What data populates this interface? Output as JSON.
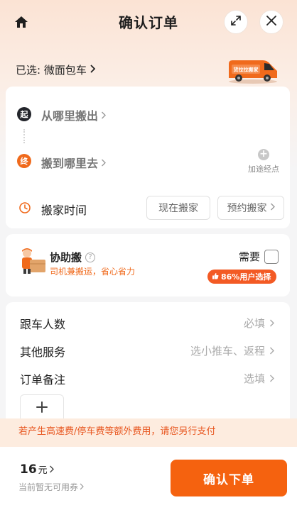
{
  "header": {
    "title": "确认订单",
    "home_icon": "home-icon",
    "expand_icon": "expand-icon",
    "close_icon": "close-icon"
  },
  "vehicle": {
    "selected_label": "已选: 微面包车",
    "van_text": "货拉拉搬家"
  },
  "route": {
    "start_badge": "起",
    "end_badge": "终",
    "from_placeholder": "从哪里搬出",
    "to_placeholder": "搬到哪里去",
    "add_stop_icon": "+",
    "add_stop_label": "加途经点",
    "time_label": "搬家时间",
    "time_now": "现在搬家",
    "time_schedule": "预约搬家"
  },
  "helper": {
    "title": "协助搬",
    "help_icon": "?",
    "subtitle": "司机兼搬运，省心省力",
    "need_label": "需要",
    "badge": "86%用户选择",
    "need_checked": false
  },
  "details": {
    "rows": [
      {
        "label": "跟车人数",
        "value": "必填"
      },
      {
        "label": "其他服务",
        "value": "选小推车、返程"
      },
      {
        "label": "订单备注",
        "value": "选填"
      }
    ],
    "add_photo_icon": "plus-icon"
  },
  "notice": "若产生高速费/停车费等额外费用，请您另行支付",
  "footer": {
    "price_amount": "16",
    "price_unit": "元",
    "coupon_text": "当前暂无可用券",
    "confirm_label": "确认下单"
  },
  "colors": {
    "accent": "#f5620f",
    "badge": "#f35a24",
    "notice_bg": "#fdecdf",
    "start_dot": "#23252b"
  }
}
